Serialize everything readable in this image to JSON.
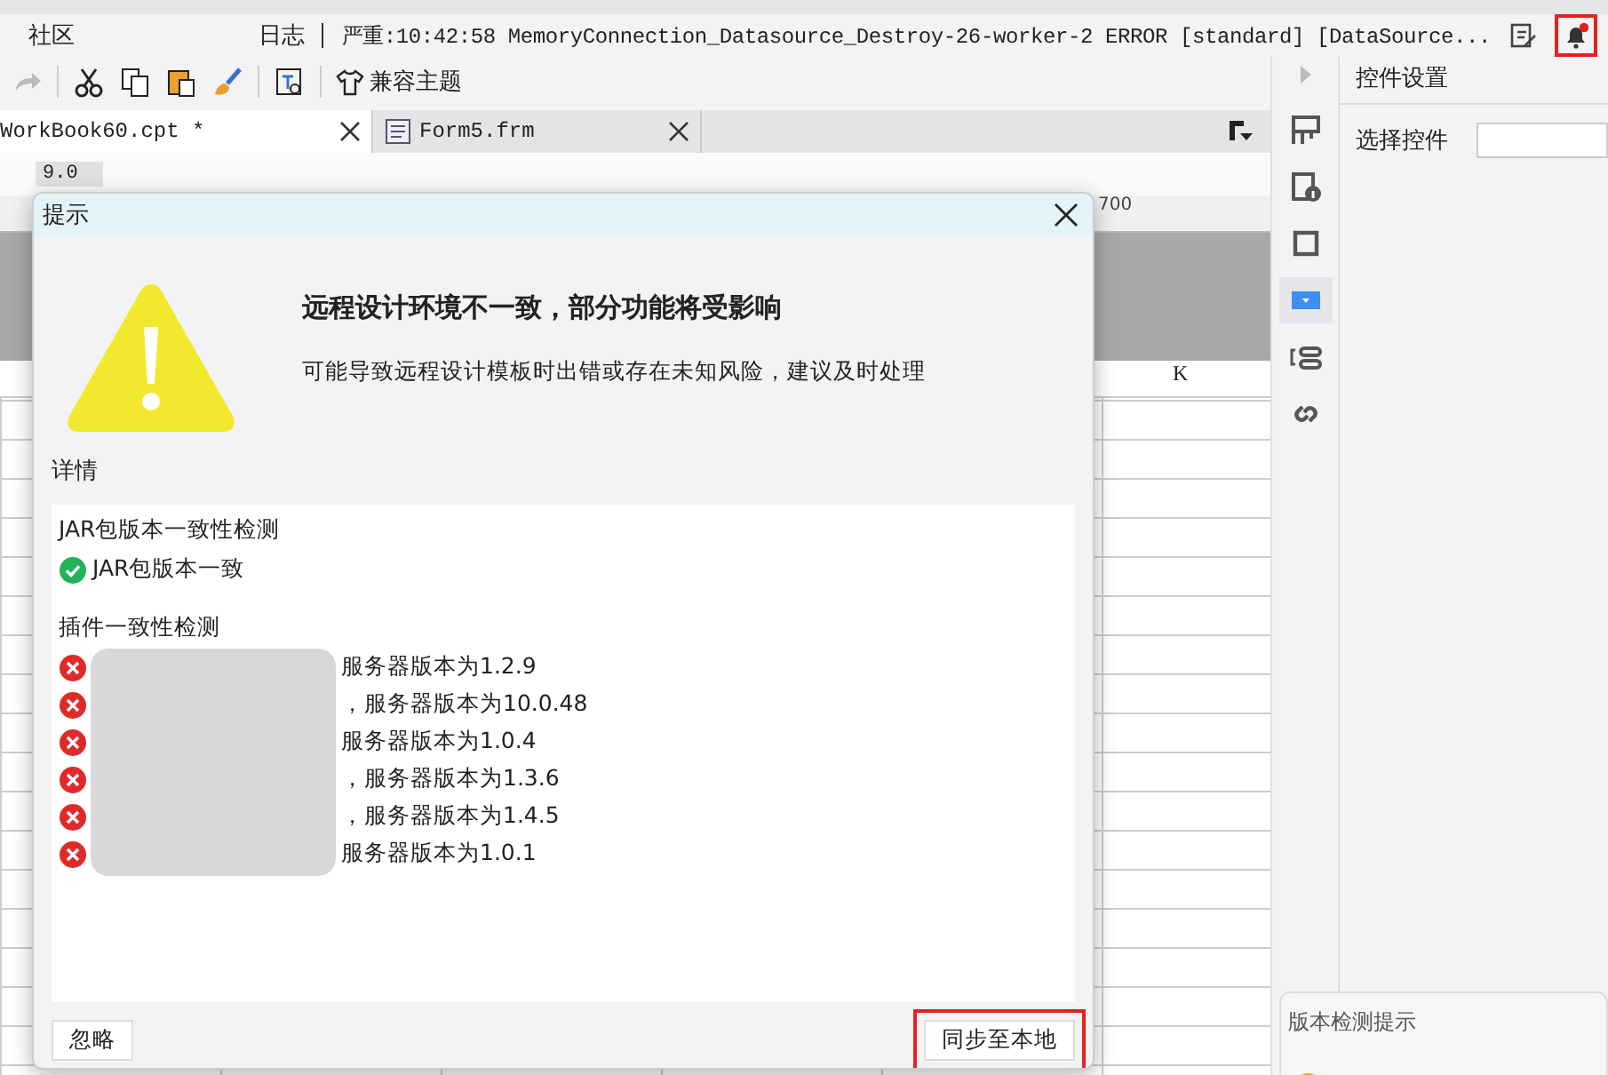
{
  "top_bar": {
    "community": "社区",
    "log_label": "日志",
    "log_message": "严重:10:42:58 MemoryConnection_Datasource_Destroy-26-worker-2 ERROR [standard] [DataSource...",
    "bell_highlighted": true,
    "bell_alert": true
  },
  "toolbar": {
    "theme_button": "兼容主题"
  },
  "tabs": [
    {
      "label": "WorkBook60.cpt *",
      "selected": true
    },
    {
      "label": "Form5.frm",
      "selected": false
    }
  ],
  "format_bar": {
    "font_size": "9.0"
  },
  "ruler": {
    "mark": "700"
  },
  "grid": {
    "column_label": "K"
  },
  "side_icons": [
    {
      "kind": "frame",
      "selected": false
    },
    {
      "kind": "info",
      "selected": false
    },
    {
      "kind": "square",
      "selected": false
    },
    {
      "kind": "dropdown",
      "selected": true
    },
    {
      "kind": "bracket",
      "selected": false
    },
    {
      "kind": "link",
      "selected": false
    }
  ],
  "side_panel": {
    "title": "控件设置",
    "field_label": "选择控件"
  },
  "dialog": {
    "title": "提示",
    "heading": "远程设计环境不一致，部分功能将受影响",
    "message": "可能导致远程设计模板时出错或存在未知风险，建议及时处理",
    "details_label": "详情",
    "sections": [
      {
        "title": "JAR包版本一致性检测",
        "items": [
          {
            "passed": true,
            "text": "JAR包版本一致"
          }
        ]
      },
      {
        "title": "插件一致性检测",
        "blurred": true,
        "items": [
          {
            "passed": false,
            "text": "服务器版本为1.2.9"
          },
          {
            "passed": false,
            "text": "，服务器版本为10.0.48"
          },
          {
            "passed": false,
            "text": "服务器版本为1.0.4"
          },
          {
            "passed": false,
            "text": "，服务器版本为1.3.6"
          },
          {
            "passed": false,
            "text": "，服务器版本为1.4.5"
          },
          {
            "passed": false,
            "text": "服务器版本为1.0.1"
          }
        ]
      }
    ],
    "buttons": [
      {
        "label": "忽略",
        "highlighted": false
      },
      {
        "label": "同步至本地",
        "highlighted": true
      }
    ]
  },
  "notice": {
    "title": "版本检测提示"
  }
}
